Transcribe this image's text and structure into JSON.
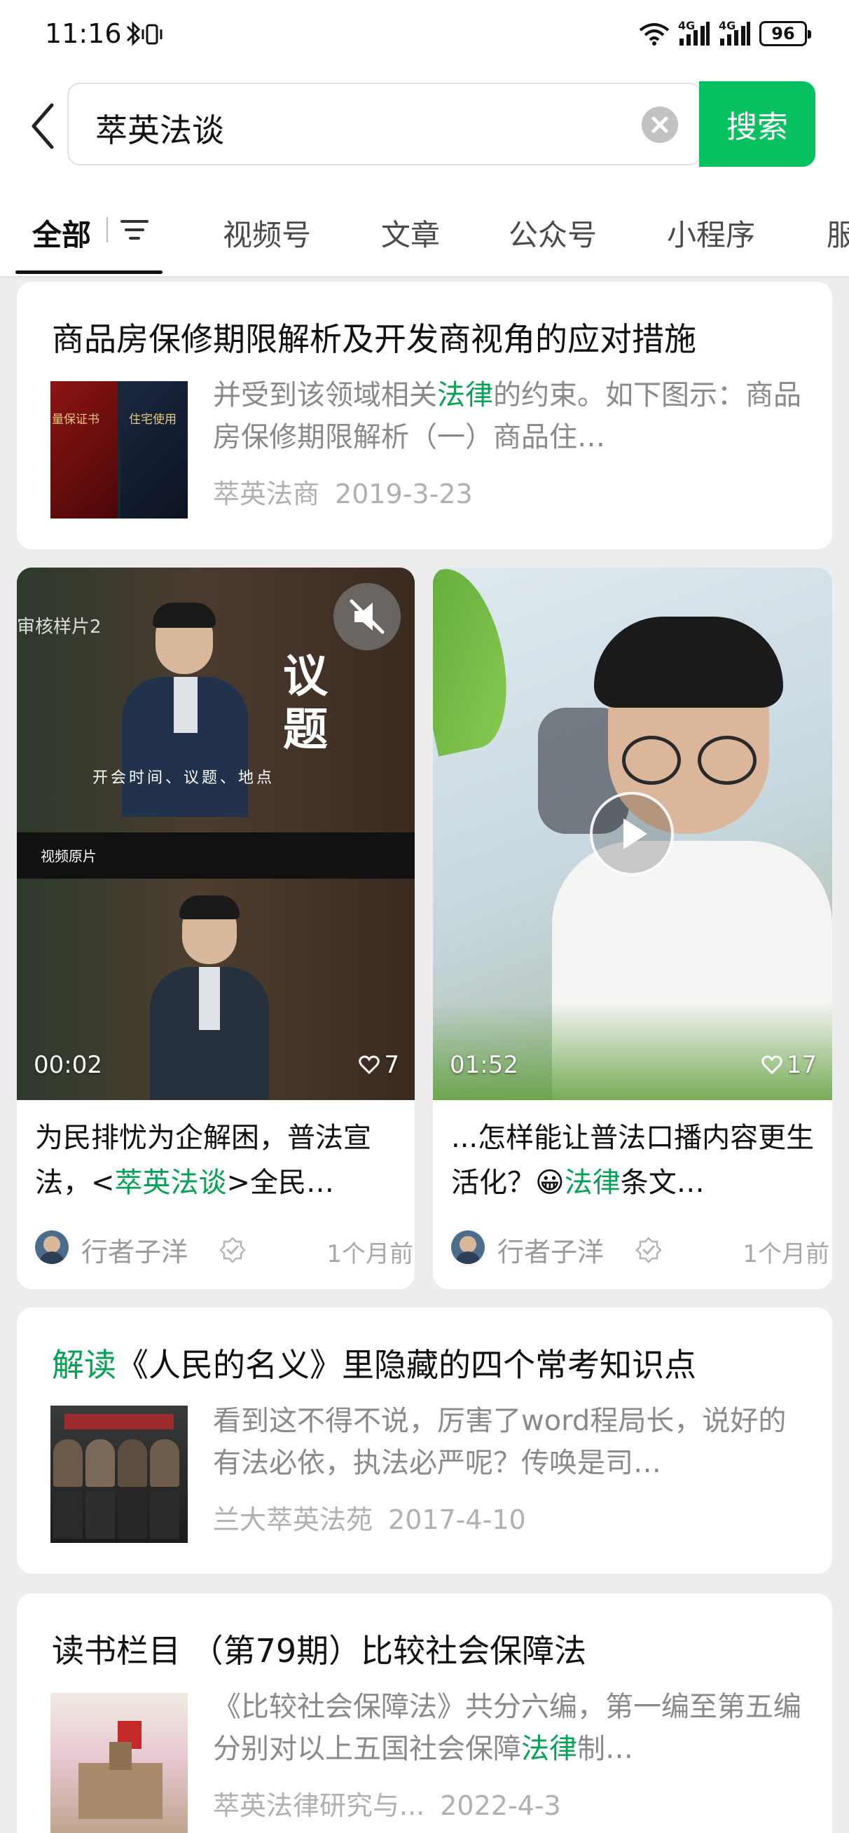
{
  "status_bar": {
    "time": "11:16",
    "battery": "96",
    "network_1": "4G",
    "network_2": "4G"
  },
  "search": {
    "query": "萃英法谈",
    "button_label": "搜索"
  },
  "tabs": [
    {
      "label": "全部",
      "active": true
    },
    {
      "label": "视频号"
    },
    {
      "label": "文章"
    },
    {
      "label": "公众号"
    },
    {
      "label": "小程序"
    },
    {
      "label": "服"
    }
  ],
  "results": {
    "article_1": {
      "title": "商品房保修期限解析及开发商视角的应对措施",
      "snippet_a": "并受到该领域相关",
      "snippet_hl": "法律",
      "snippet_b": "的约束。如下图示：商品房保修期限解析（一）商品住…",
      "source": "萃英法商",
      "date": "2019-3-23",
      "thumb_text_1": "量保证书",
      "thumb_text_2": "住宅使用"
    },
    "video_1": {
      "overlay_1": "审核样片2",
      "overlay_2": "议",
      "overlay_3": "题",
      "overlay_4": "开会时间、议题、地点",
      "overlay_5": "视频原片",
      "duration": "00:02",
      "likes": "7",
      "caption_a": "为民排忧为企解困，普法宣法，<",
      "caption_hl": "萃英法谈",
      "caption_b": ">全民…",
      "author": "行者子洋",
      "ago": "1个月前"
    },
    "video_2": {
      "duration": "01:52",
      "likes": "17",
      "caption_a": "...怎样能让普法口播内容更生活化？😀",
      "caption_hl": "法律",
      "caption_b": "条文…",
      "author": "行者子洋",
      "ago": "1个月前"
    },
    "article_2": {
      "title_hl": "解读",
      "title_rest": "《人民的名义》里隐藏的四个常考知识点",
      "snippet": "看到这不得不说，厉害了word程局长，说好的有法必依，执法必严呢？传唤是司…",
      "source": "兰大萃英法苑",
      "date": "2017-4-10"
    },
    "article_3": {
      "title": "读书栏目 （第79期）比较社会保障法",
      "snippet_a": "《比较社会保障法》共分六编，第一编至第五编分别对以上五国社会保障",
      "snippet_hl": "法律",
      "snippet_b": "制…",
      "source": "萃英法律研究与...",
      "date": "2022-4-3"
    }
  },
  "colors": {
    "accent": "#07c160",
    "highlight": "#07a155",
    "background": "#ededed"
  }
}
